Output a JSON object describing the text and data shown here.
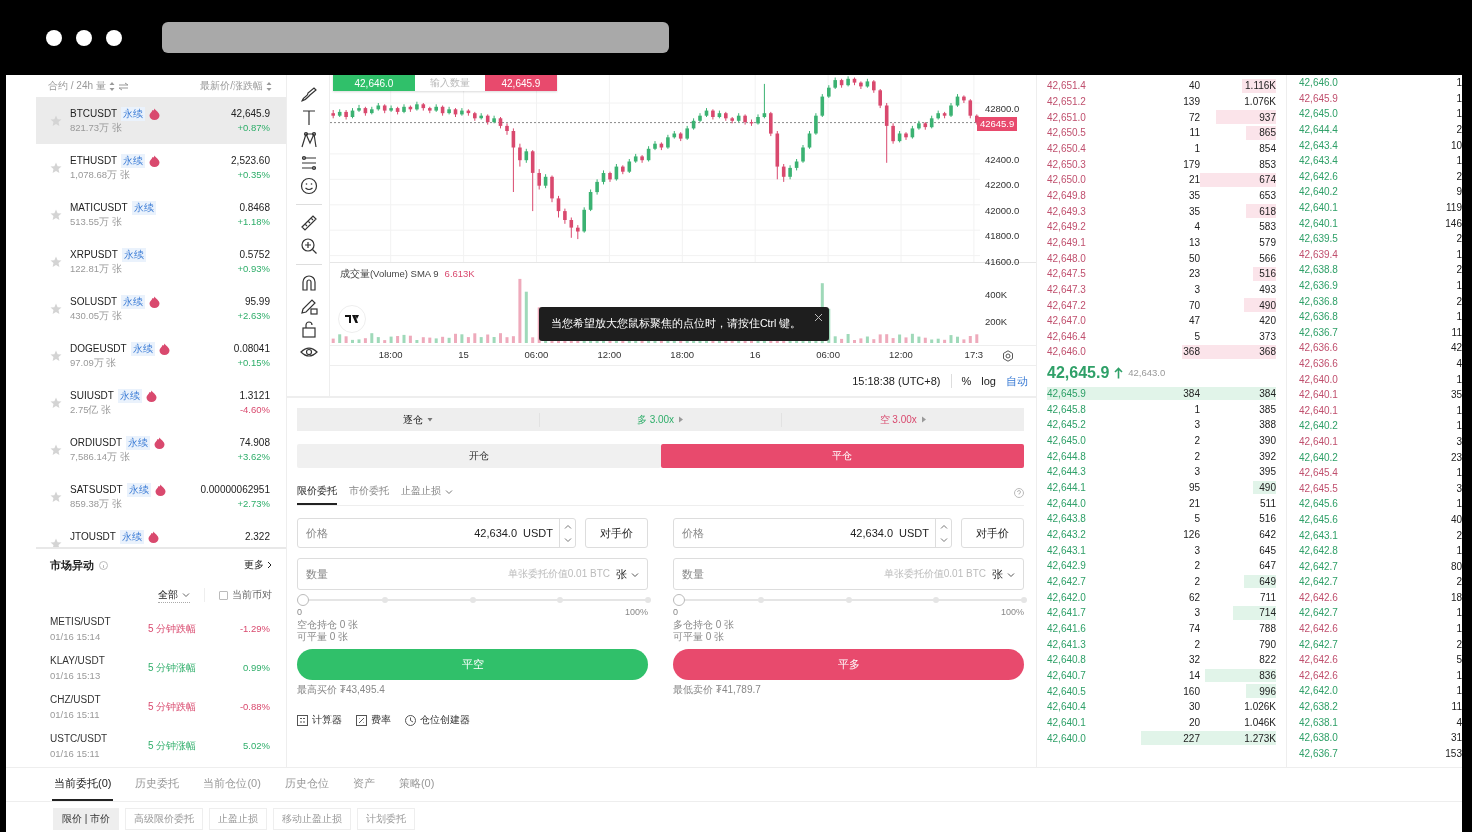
{
  "markets": {
    "header_left": "合约 / 24h 量",
    "header_right": "最新价/涨跌幅",
    "rows": [
      {
        "symbol": "BTCUSDT",
        "tag": "永续",
        "hot": true,
        "starred": false,
        "volume": "821.73万 张",
        "price": "42,645.9",
        "change": "+0.87%",
        "kind": "up",
        "selected": true
      },
      {
        "symbol": "ETHUSDT",
        "tag": "永续",
        "hot": true,
        "starred": false,
        "volume": "1,078.68万 张",
        "price": "2,523.60",
        "change": "+0.35%",
        "kind": "up",
        "selected": false
      },
      {
        "symbol": "MATICUSDT",
        "tag": "永续",
        "hot": false,
        "starred": false,
        "volume": "513.55万 张",
        "price": "0.8468",
        "change": "+1.18%",
        "kind": "up",
        "selected": false
      },
      {
        "symbol": "XRPUSDT",
        "tag": "永续",
        "hot": false,
        "starred": false,
        "volume": "122.81万 张",
        "price": "0.5752",
        "change": "+0.93%",
        "kind": "up",
        "selected": false
      },
      {
        "symbol": "SOLUSDT",
        "tag": "永续",
        "hot": true,
        "starred": false,
        "volume": "430.05万 张",
        "price": "95.99",
        "change": "+2.63%",
        "kind": "up",
        "selected": false
      },
      {
        "symbol": "DOGEUSDT",
        "tag": "永续",
        "hot": true,
        "starred": false,
        "volume": "97.09万 张",
        "price": "0.08041",
        "change": "+0.15%",
        "kind": "up",
        "selected": false
      },
      {
        "symbol": "SUIUSDT",
        "tag": "永续",
        "hot": true,
        "starred": false,
        "volume": "2.75亿 张",
        "price": "1.3121",
        "change": "-4.60%",
        "kind": "down",
        "selected": false
      },
      {
        "symbol": "ORDIUSDT",
        "tag": "永续",
        "hot": true,
        "starred": false,
        "volume": "7,586.14万 张",
        "price": "74.908",
        "change": "+3.62%",
        "kind": "up",
        "selected": false
      },
      {
        "symbol": "SATSUSDT",
        "tag": "永续",
        "hot": true,
        "starred": false,
        "volume": "859.38万 张",
        "price": "0.00000062951",
        "change": "+2.73%",
        "kind": "up",
        "selected": false
      },
      {
        "symbol": "JTOUSDT",
        "tag": "永续",
        "hot": true,
        "starred": false,
        "price": "2.322",
        "selected": false
      }
    ]
  },
  "movers": {
    "title": "市场异动",
    "more": "更多",
    "filter": "全部",
    "checkbox": {
      "label": "当前币对",
      "checked": false
    },
    "rows": [
      {
        "pair": "METIS/USDT",
        "time": "01/16 15:14",
        "label": "5 分钟跌幅",
        "value": "-1.29%",
        "kind": "down"
      },
      {
        "pair": "KLAY/USDT",
        "time": "01/16 15:13",
        "label": "5 分钟涨幅",
        "value": "0.99%",
        "kind": "up"
      },
      {
        "pair": "CHZ/USDT",
        "time": "01/16 15:11",
        "label": "5 分钟跌幅",
        "value": "-0.88%",
        "kind": "down"
      },
      {
        "pair": "USTC/USDT",
        "time": "01/16 15:11",
        "label": "5 分钟涨幅",
        "value": "5.02%",
        "kind": "up"
      }
    ]
  },
  "chart": {
    "quick_trade": {
      "buy": "42,646.0",
      "amount_placeholder": "输入数量",
      "sell": "42,645.9"
    },
    "chart_data": {
      "type": "candlestick",
      "ylim": [
        41550,
        43020
      ],
      "grid": true,
      "ref_lines": [
        {
          "axis": "y",
          "value": 42645.9,
          "label": "42645.9"
        }
      ],
      "yticks": [
        {
          "value": 42800,
          "label": "42800.0"
        },
        {
          "value": 42400,
          "label": "42400.0"
        },
        {
          "value": 42200,
          "label": "42200.0"
        },
        {
          "value": 42000,
          "label": "42000.0"
        },
        {
          "value": 41800,
          "label": "41800.0"
        },
        {
          "value": 41600,
          "label": "41600.0"
        }
      ],
      "categories": [
        null,
        null,
        null,
        null,
        null,
        null,
        null,
        null,
        null,
        null,
        null,
        null,
        null,
        null,
        null,
        null,
        null,
        null,
        null,
        null,
        null,
        null,
        null,
        null,
        null,
        null,
        null,
        null,
        null,
        null,
        null,
        null,
        null,
        null,
        null,
        null,
        null,
        null,
        null,
        null,
        null,
        null,
        null,
        null,
        null,
        null,
        null,
        null,
        null,
        null,
        null,
        null,
        null,
        null,
        null,
        null,
        null,
        null,
        null,
        null,
        null,
        null,
        null,
        null,
        null,
        null,
        null,
        null,
        null,
        null,
        null,
        null,
        null,
        null,
        null,
        null,
        null,
        null,
        null,
        null,
        null,
        null,
        null,
        null,
        null,
        null,
        null,
        null,
        null,
        null,
        null,
        null,
        null,
        null,
        null,
        null,
        null,
        null,
        null,
        null,
        null
      ],
      "ohlc": [
        [
          42720,
          42745,
          42680,
          42700
        ],
        [
          42700,
          42750,
          42690,
          42730
        ],
        [
          42730,
          42745,
          42670,
          42690
        ],
        [
          42690,
          42760,
          42680,
          42740
        ],
        [
          42740,
          42785,
          42730,
          42760
        ],
        [
          42760,
          42770,
          42700,
          42720
        ],
        [
          42720,
          42770,
          42710,
          42750
        ],
        [
          42750,
          42800,
          42740,
          42780
        ],
        [
          42780,
          42790,
          42720,
          42740
        ],
        [
          42740,
          42780,
          42730,
          42760
        ],
        [
          42760,
          42770,
          42710,
          42730
        ],
        [
          42730,
          42790,
          42720,
          42770
        ],
        [
          42770,
          42780,
          42730,
          42750
        ],
        [
          42750,
          42810,
          42740,
          42790
        ],
        [
          42790,
          42800,
          42740,
          42760
        ],
        [
          42760,
          42770,
          42720,
          42740
        ],
        [
          42740,
          42790,
          42730,
          42770
        ],
        [
          42770,
          42780,
          42700,
          42720
        ],
        [
          42720,
          42770,
          42710,
          42750
        ],
        [
          42750,
          42760,
          42690,
          42710
        ],
        [
          42710,
          42760,
          42700,
          42740
        ],
        [
          42740,
          42750,
          42700,
          42720
        ],
        [
          42720,
          42730,
          42660,
          42680
        ],
        [
          42680,
          42720,
          42670,
          42700
        ],
        [
          42700,
          42710,
          42630,
          42650
        ],
        [
          42650,
          42700,
          42640,
          42680
        ],
        [
          42680,
          42690,
          42600,
          42620
        ],
        [
          42620,
          42640,
          42550,
          42580
        ],
        [
          42580,
          42600,
          42100,
          42450
        ],
        [
          42450,
          42480,
          42300,
          42350
        ],
        [
          42350,
          42440,
          42330,
          42420
        ],
        [
          42420,
          42430,
          41950,
          42250
        ],
        [
          42250,
          42280,
          42120,
          42150
        ],
        [
          42150,
          42240,
          42130,
          42220
        ],
        [
          42220,
          42230,
          42020,
          42050
        ],
        [
          42050,
          42070,
          41900,
          41950
        ],
        [
          41950,
          41970,
          41850,
          41880
        ],
        [
          41880,
          41900,
          41740,
          41820
        ],
        [
          41820,
          41840,
          41730,
          41790
        ],
        [
          41790,
          41980,
          41780,
          41960
        ],
        [
          41960,
          42120,
          41950,
          42100
        ],
        [
          42100,
          42200,
          42080,
          42180
        ],
        [
          42180,
          42270,
          42160,
          42250
        ],
        [
          42250,
          42260,
          42180,
          42200
        ],
        [
          42200,
          42320,
          42190,
          42300
        ],
        [
          42300,
          42310,
          42240,
          42260
        ],
        [
          42260,
          42360,
          42250,
          42340
        ],
        [
          42340,
          42400,
          42330,
          42380
        ],
        [
          42380,
          42390,
          42330,
          42350
        ],
        [
          42350,
          42460,
          42340,
          42440
        ],
        [
          42440,
          42500,
          42430,
          42480
        ],
        [
          42480,
          42490,
          42430,
          42450
        ],
        [
          42450,
          42550,
          42440,
          42530
        ],
        [
          42530,
          42580,
          42520,
          42560
        ],
        [
          42560,
          42570,
          42500,
          42520
        ],
        [
          42520,
          42620,
          42510,
          42600
        ],
        [
          42600,
          42680,
          42590,
          42660
        ],
        [
          42660,
          42720,
          42650,
          42700
        ],
        [
          42700,
          42760,
          42690,
          42740
        ],
        [
          42740,
          42750,
          42670,
          42690
        ],
        [
          42690,
          42740,
          42680,
          42720
        ],
        [
          42720,
          42730,
          42660,
          42680
        ],
        [
          42680,
          42690,
          42640,
          42660
        ],
        [
          42660,
          42720,
          42650,
          42700
        ],
        [
          42700,
          42710,
          42630,
          42650
        ],
        [
          42650,
          42670,
          42620,
          42640
        ],
        [
          42640,
          42710,
          42630,
          42690
        ],
        [
          42690,
          42950,
          42680,
          42720
        ],
        [
          42720,
          42730,
          42540,
          42560
        ],
        [
          42560,
          42580,
          42200,
          42300
        ],
        [
          42300,
          42320,
          42180,
          42220
        ],
        [
          42220,
          42310,
          42200,
          42290
        ],
        [
          42290,
          42360,
          42270,
          42340
        ],
        [
          42340,
          42470,
          42330,
          42450
        ],
        [
          42450,
          42580,
          42440,
          42560
        ],
        [
          42560,
          42720,
          42550,
          42700
        ],
        [
          42700,
          42870,
          42690,
          42850
        ],
        [
          42850,
          42940,
          42840,
          42920
        ],
        [
          42920,
          43000,
          42910,
          42980
        ],
        [
          42980,
          42990,
          42920,
          42940
        ],
        [
          42940,
          43010,
          42930,
          42990
        ],
        [
          42990,
          43000,
          42940,
          42960
        ],
        [
          42960,
          42970,
          42910,
          42930
        ],
        [
          42930,
          42990,
          42920,
          42970
        ],
        [
          42970,
          42980,
          42880,
          42900
        ],
        [
          42900,
          42910,
          42760,
          42780
        ],
        [
          42780,
          42800,
          42330,
          42620
        ],
        [
          42620,
          42640,
          42480,
          42500
        ],
        [
          42500,
          42580,
          42490,
          42560
        ],
        [
          42560,
          42570,
          42510,
          42530
        ],
        [
          42530,
          42620,
          42520,
          42600
        ],
        [
          42600,
          42660,
          42590,
          42640
        ],
        [
          42640,
          42650,
          42590,
          42610
        ],
        [
          42610,
          42700,
          42600,
          42680
        ],
        [
          42680,
          42740,
          42670,
          42720
        ],
        [
          42720,
          42730,
          42680,
          42700
        ],
        [
          42700,
          42800,
          42690,
          42780
        ],
        [
          42780,
          42870,
          42770,
          42850
        ],
        [
          42850,
          42860,
          42800,
          42820
        ],
        [
          42820,
          42830,
          42680,
          42700
        ],
        [
          42700,
          42710,
          42630,
          42645.9
        ]
      ]
    },
    "x_axis": [
      "18:00",
      "15",
      "06:00",
      "12:00",
      "18:00",
      "16",
      "06:00",
      "12:00",
      "17:3"
    ],
    "volume_axis": [
      "400K",
      "200K"
    ],
    "volume_label": "成交量(Volume) SMA 9",
    "volume_value": "6.613K",
    "tooltip": "当您希望放大您鼠标聚焦的点位时，请按住Ctrl 键。",
    "footer": {
      "time": "15:18:38 (UTC+8)",
      "percent": "%",
      "log": "log",
      "auto": "自动"
    }
  },
  "order_form": {
    "margin_mode": "逐仓",
    "long_leverage": "多 3.00x",
    "short_leverage": "空 3.00x",
    "tabs": [
      {
        "label": "开仓",
        "kind": "open",
        "selected": false
      },
      {
        "label": "平仓",
        "kind": "close",
        "selected": true
      }
    ],
    "order_types": [
      {
        "label": "限价委托",
        "selected": true,
        "dropdown": false
      },
      {
        "label": "市价委托",
        "selected": false,
        "dropdown": false
      },
      {
        "label": "止盈止损",
        "selected": false,
        "dropdown": true
      }
    ],
    "sides": [
      {
        "kind": "buy",
        "price_label": "价格",
        "price": "42,634.0",
        "unit": "USDT",
        "counter_price": "对手价",
        "qty_label": "数量",
        "qty_placeholder": "单张委托价值0.01 BTC",
        "qty_unit": "张",
        "level": 0,
        "min": "0",
        "max": "100%",
        "holding": "空仓持仓 0 张",
        "closable": "可平量 0 张",
        "action": "平空",
        "limit": "最高买价 ₮43,495.4"
      },
      {
        "kind": "sell",
        "price_label": "价格",
        "price": "42,634.0",
        "unit": "USDT",
        "counter_price": "对手价",
        "qty_label": "数量",
        "qty_placeholder": "单张委托价值0.01 BTC",
        "qty_unit": "张",
        "level": 0,
        "min": "0",
        "max": "100%",
        "holding": "多仓持仓 0 张",
        "closable": "可平量 0 张",
        "action": "平多",
        "limit": "最低卖价 ₮41,789.7"
      }
    ],
    "tools": [
      {
        "kind": "calculator",
        "label": "计算器"
      },
      {
        "kind": "fee",
        "label": "费率"
      },
      {
        "kind": "builder",
        "label": "仓位创建器"
      }
    ]
  },
  "order_book": {
    "asks": [
      {
        "price": "42,651.4",
        "amount": "40",
        "total": "1.116K",
        "level": 0.15
      },
      {
        "price": "42,651.2",
        "amount": "139",
        "total": "1.076K",
        "level": 0
      },
      {
        "price": "42,651.0",
        "amount": "72",
        "total": "937",
        "level": 0.26
      },
      {
        "price": "42,650.5",
        "amount": "11",
        "total": "865",
        "level": 0.13
      },
      {
        "price": "42,650.4",
        "amount": "1",
        "total": "854",
        "level": 0
      },
      {
        "price": "42,650.3",
        "amount": "179",
        "total": "853",
        "level": 0
      },
      {
        "price": "42,650.0",
        "amount": "21",
        "total": "674",
        "level": 0.33
      },
      {
        "price": "42,649.8",
        "amount": "35",
        "total": "653",
        "level": 0
      },
      {
        "price": "42,649.3",
        "amount": "35",
        "total": "618",
        "level": 0.13
      },
      {
        "price": "42,649.2",
        "amount": "4",
        "total": "583",
        "level": 0
      },
      {
        "price": "42,649.1",
        "amount": "13",
        "total": "579",
        "level": 0
      },
      {
        "price": "42,648.0",
        "amount": "50",
        "total": "566",
        "level": 0
      },
      {
        "price": "42,647.5",
        "amount": "23",
        "total": "516",
        "level": 0.1
      },
      {
        "price": "42,647.3",
        "amount": "3",
        "total": "493",
        "level": 0
      },
      {
        "price": "42,647.2",
        "amount": "70",
        "total": "490",
        "level": 0.14
      },
      {
        "price": "42,647.0",
        "amount": "47",
        "total": "420",
        "level": 0
      },
      {
        "price": "42,646.4",
        "amount": "5",
        "total": "373",
        "level": 0
      },
      {
        "price": "42,646.0",
        "amount": "368",
        "total": "368",
        "level": 0.41
      }
    ],
    "last_price": "42,645.9",
    "mark_price": "42,643.0",
    "bids": [
      {
        "price": "42,645.9",
        "amount": "384",
        "total": "384",
        "level": 1
      },
      {
        "price": "42,645.8",
        "amount": "1",
        "total": "385",
        "level": 0
      },
      {
        "price": "42,645.2",
        "amount": "3",
        "total": "388",
        "level": 0
      },
      {
        "price": "42,645.0",
        "amount": "2",
        "total": "390",
        "level": 0
      },
      {
        "price": "42,644.8",
        "amount": "2",
        "total": "392",
        "level": 0
      },
      {
        "price": "42,644.3",
        "amount": "3",
        "total": "395",
        "level": 0
      },
      {
        "price": "42,644.1",
        "amount": "95",
        "total": "490",
        "level": 0.1
      },
      {
        "price": "42,644.0",
        "amount": "21",
        "total": "511",
        "level": 0
      },
      {
        "price": "42,643.8",
        "amount": "5",
        "total": "516",
        "level": 0
      },
      {
        "price": "42,643.2",
        "amount": "126",
        "total": "642",
        "level": 0
      },
      {
        "price": "42,643.1",
        "amount": "3",
        "total": "645",
        "level": 0
      },
      {
        "price": "42,642.9",
        "amount": "2",
        "total": "647",
        "level": 0
      },
      {
        "price": "42,642.7",
        "amount": "2",
        "total": "649",
        "level": 0.14
      },
      {
        "price": "42,642.0",
        "amount": "62",
        "total": "711",
        "level": 0
      },
      {
        "price": "42,641.7",
        "amount": "3",
        "total": "714",
        "level": 0.19
      },
      {
        "price": "42,641.6",
        "amount": "74",
        "total": "788",
        "level": 0
      },
      {
        "price": "42,641.3",
        "amount": "2",
        "total": "790",
        "level": 0
      },
      {
        "price": "42,640.8",
        "amount": "32",
        "total": "822",
        "level": 0
      },
      {
        "price": "42,640.7",
        "amount": "14",
        "total": "836",
        "level": 0.31
      },
      {
        "price": "42,640.5",
        "amount": "160",
        "total": "996",
        "level": 0.13
      },
      {
        "price": "42,640.4",
        "amount": "30",
        "total": "1.026K",
        "level": 0
      },
      {
        "price": "42,640.1",
        "amount": "20",
        "total": "1.046K",
        "level": 0
      },
      {
        "price": "42,640.0",
        "amount": "227",
        "total": "1.273K",
        "level": 0.59
      }
    ]
  },
  "trades": [
    {
      "price": "42,646.0",
      "qty": "1",
      "kind": "buy"
    },
    {
      "price": "42,645.9",
      "qty": "1",
      "kind": "sell"
    },
    {
      "price": "42,645.0",
      "qty": "1",
      "kind": "buy"
    },
    {
      "price": "42,644.4",
      "qty": "2",
      "kind": "buy"
    },
    {
      "price": "42,643.4",
      "qty": "10",
      "kind": "buy"
    },
    {
      "price": "42,643.4",
      "qty": "1",
      "kind": "buy"
    },
    {
      "price": "42,642.6",
      "qty": "2",
      "kind": "buy"
    },
    {
      "price": "42,640.2",
      "qty": "9",
      "kind": "buy"
    },
    {
      "price": "42,640.1",
      "qty": "119",
      "kind": "buy"
    },
    {
      "price": "42,640.1",
      "qty": "146",
      "kind": "buy"
    },
    {
      "price": "42,639.5",
      "qty": "2",
      "kind": "buy"
    },
    {
      "price": "42,639.4",
      "qty": "1",
      "kind": "sell"
    },
    {
      "price": "42,638.8",
      "qty": "2",
      "kind": "buy"
    },
    {
      "price": "42,636.9",
      "qty": "1",
      "kind": "buy"
    },
    {
      "price": "42,636.8",
      "qty": "2",
      "kind": "buy"
    },
    {
      "price": "42,636.8",
      "qty": "1",
      "kind": "buy"
    },
    {
      "price": "42,636.7",
      "qty": "11",
      "kind": "buy"
    },
    {
      "price": "42,636.6",
      "qty": "42",
      "kind": "sell"
    },
    {
      "price": "42,636.6",
      "qty": "4",
      "kind": "sell"
    },
    {
      "price": "42,640.0",
      "qty": "1",
      "kind": "sell"
    },
    {
      "price": "42,640.1",
      "qty": "35",
      "kind": "sell"
    },
    {
      "price": "42,640.1",
      "qty": "1",
      "kind": "sell"
    },
    {
      "price": "42,640.2",
      "qty": "1",
      "kind": "buy"
    },
    {
      "price": "42,640.1",
      "qty": "3",
      "kind": "sell"
    },
    {
      "price": "42,640.2",
      "qty": "23",
      "kind": "buy"
    },
    {
      "price": "42,645.4",
      "qty": "1",
      "kind": "sell"
    },
    {
      "price": "42,645.5",
      "qty": "3",
      "kind": "sell"
    },
    {
      "price": "42,645.6",
      "qty": "1",
      "kind": "buy"
    },
    {
      "price": "42,645.6",
      "qty": "40",
      "kind": "buy"
    },
    {
      "price": "42,643.1",
      "qty": "2",
      "kind": "buy"
    },
    {
      "price": "42,642.8",
      "qty": "1",
      "kind": "buy"
    },
    {
      "price": "42,642.7",
      "qty": "80",
      "kind": "buy"
    },
    {
      "price": "42,642.7",
      "qty": "2",
      "kind": "buy"
    },
    {
      "price": "42,642.6",
      "qty": "18",
      "kind": "sell"
    },
    {
      "price": "42,642.7",
      "qty": "1",
      "kind": "buy"
    },
    {
      "price": "42,642.6",
      "qty": "1",
      "kind": "sell"
    },
    {
      "price": "42,642.7",
      "qty": "2",
      "kind": "buy"
    },
    {
      "price": "42,642.6",
      "qty": "5",
      "kind": "sell"
    },
    {
      "price": "42,642.6",
      "qty": "1",
      "kind": "sell"
    },
    {
      "price": "42,642.0",
      "qty": "1",
      "kind": "buy"
    },
    {
      "price": "42,638.2",
      "qty": "11",
      "kind": "buy"
    },
    {
      "price": "42,638.1",
      "qty": "4",
      "kind": "buy"
    },
    {
      "price": "42,638.0",
      "qty": "31",
      "kind": "buy"
    },
    {
      "price": "42,636.7",
      "qty": "153",
      "kind": "buy"
    }
  ],
  "bottom": {
    "tabs": [
      {
        "label": "当前委托(0)",
        "selected": true
      },
      {
        "label": "历史委托",
        "selected": false
      },
      {
        "label": "当前仓位(0)",
        "selected": false
      },
      {
        "label": "历史仓位",
        "selected": false
      },
      {
        "label": "资产",
        "selected": false
      },
      {
        "label": "策略(0)",
        "selected": false
      }
    ],
    "subtabs": [
      {
        "label": "限价 | 市价",
        "selected": true
      },
      {
        "label": "高级限价委托",
        "selected": false
      },
      {
        "label": "止盈止损",
        "selected": false
      },
      {
        "label": "移动止盈止损",
        "selected": false
      },
      {
        "label": "计划委托",
        "selected": false
      }
    ]
  }
}
